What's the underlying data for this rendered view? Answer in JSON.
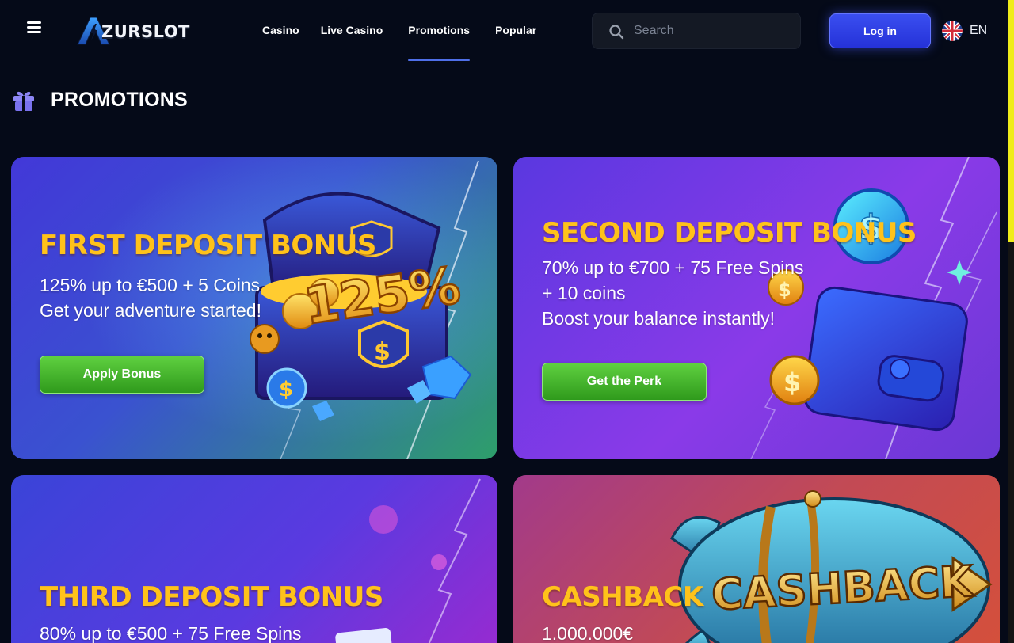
{
  "header": {
    "logo_text": "ZURSLOT",
    "nav": [
      "Casino",
      "Live Casino",
      "Promotions",
      "Popular"
    ],
    "active_nav": "Promotions",
    "search_placeholder": "Search",
    "login_label": "Log in",
    "language": "EN"
  },
  "page": {
    "title": "PROMOTIONS"
  },
  "promotions": [
    {
      "title": "FIRST DEPOSIT BONUS",
      "lines": [
        "125% up to €500 + 5 Coins",
        "Get your adventure started!"
      ],
      "cta": "Apply Bonus",
      "art_text": "125%"
    },
    {
      "title": "SECOND DEPOSIT BONUS",
      "lines": [
        "70% up to €700 + 75 Free Spins",
        "+ 10 coins",
        "Boost your balance instantly!"
      ],
      "cta": "Get the Perk"
    },
    {
      "title": "THIRD DEPOSIT BONUS",
      "lines": [
        "80% up to €500 + 75 Free Spins"
      ]
    },
    {
      "title": "CASHBACK",
      "lines": [
        "1.000.000€"
      ],
      "art_text": "CASHBACK"
    }
  ],
  "colors": {
    "background": "#050a18",
    "promo_title": "#ffc21a",
    "login_button": "#2f3ee6",
    "cta_button": "#45b52c",
    "active_underline": "#4f6fe8",
    "scroll_thumb": "#f0ec1a"
  },
  "icons": [
    "menu-icon",
    "search-icon",
    "uk-flag-icon",
    "gift-icon",
    "dollar-coin-icon",
    "lightning-icon"
  ]
}
